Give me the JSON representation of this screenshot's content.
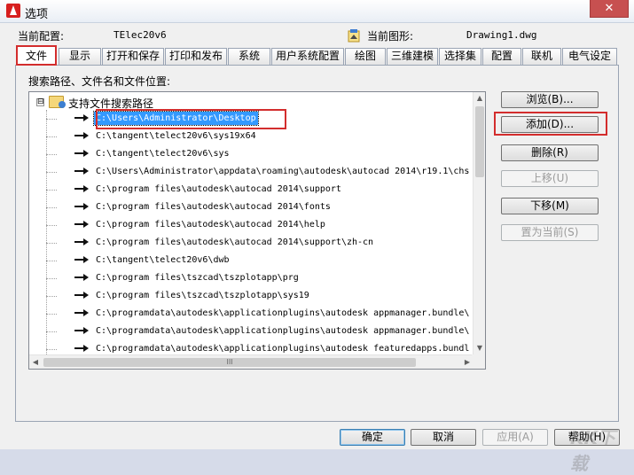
{
  "window": {
    "title": "选项",
    "close_symbol": "✕"
  },
  "config": {
    "current_profile_label": "当前配置:",
    "current_profile_value": "TElec20v6",
    "current_drawing_label": "当前图形:",
    "current_drawing_value": "Drawing1.dwg"
  },
  "tabs": [
    {
      "label": "文件"
    },
    {
      "label": "显示"
    },
    {
      "label": "打开和保存"
    },
    {
      "label": "打印和发布"
    },
    {
      "label": "系统"
    },
    {
      "label": "用户系统配置"
    },
    {
      "label": "绘图"
    },
    {
      "label": "三维建模"
    },
    {
      "label": "选择集"
    },
    {
      "label": "配置"
    },
    {
      "label": "联机"
    },
    {
      "label": "电气设定"
    }
  ],
  "panel": {
    "caption": "搜索路径、文件名和文件位置:"
  },
  "tree": {
    "expander_symbol": "⊟",
    "root_label": "支持文件搜索路径",
    "items": [
      {
        "path": "C:\\Users\\Administrator\\Desktop"
      },
      {
        "path": "C:\\tangent\\telect20v6\\sys19x64"
      },
      {
        "path": "C:\\tangent\\telect20v6\\sys"
      },
      {
        "path": "C:\\Users\\Administrator\\appdata\\roaming\\autodesk\\autocad 2014\\r19.1\\chs"
      },
      {
        "path": "C:\\program files\\autodesk\\autocad 2014\\support"
      },
      {
        "path": "C:\\program files\\autodesk\\autocad 2014\\fonts"
      },
      {
        "path": "C:\\program files\\autodesk\\autocad 2014\\help"
      },
      {
        "path": "C:\\program files\\autodesk\\autocad 2014\\support\\zh-cn"
      },
      {
        "path": "C:\\tangent\\telect20v6\\dwb"
      },
      {
        "path": "C:\\program files\\tszcad\\tszplotapp\\prg"
      },
      {
        "path": "C:\\program files\\tszcad\\tszplotapp\\sys19"
      },
      {
        "path": "C:\\programdata\\autodesk\\applicationplugins\\autodesk appmanager.bundle\\"
      },
      {
        "path": "C:\\programdata\\autodesk\\applicationplugins\\autodesk appmanager.bundle\\"
      },
      {
        "path": "C:\\programdata\\autodesk\\applicationplugins\\autodesk featuredapps.bundl"
      }
    ]
  },
  "scrollbar": {
    "up": "▲",
    "down": "▼",
    "left": "◀",
    "right": "▶",
    "grip": "III"
  },
  "side_buttons": {
    "browse": "浏览(B)...",
    "add": "添加(D)...",
    "remove": "删除(R)",
    "move_up": "上移(U)",
    "move_down": "下移(M)",
    "set_current": "置为当前(S)"
  },
  "bottom_buttons": {
    "ok": "确定",
    "cancel": "取消",
    "apply": "应用(A)",
    "help": "帮助(H)"
  },
  "watermark": "KK下载"
}
